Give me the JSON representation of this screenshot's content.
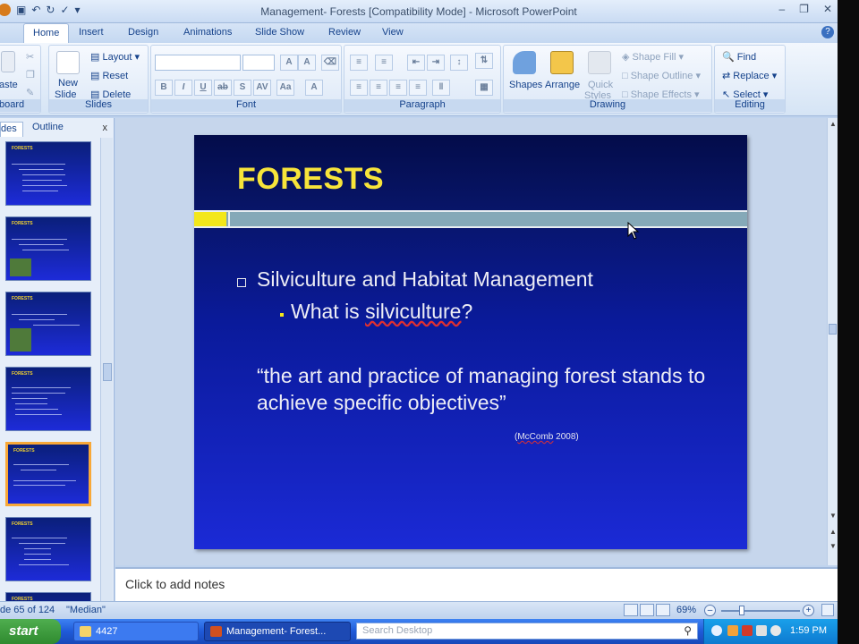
{
  "window": {
    "title": "Management- Forests [Compatibility Mode] - Microsoft PowerPoint"
  },
  "ribbon": {
    "tabs": [
      "Home",
      "Insert",
      "Design",
      "Animations",
      "Slide Show",
      "Review",
      "View"
    ],
    "clipboard": {
      "paste": "aste",
      "label": "board"
    },
    "slides": {
      "new_slide_line1": "New",
      "new_slide_line2": "Slide",
      "layout": "Layout",
      "reset": "Reset",
      "delete": "Delete",
      "label": "Slides"
    },
    "font": {
      "label": "Font"
    },
    "paragraph": {
      "label": "Paragraph"
    },
    "drawing": {
      "shapes": "Shapes",
      "arrange": "Arrange",
      "quick_styles_1": "Quick",
      "quick_styles_2": "Styles",
      "shape_fill": "Shape Fill",
      "shape_outline": "Shape Outline",
      "shape_effects": "Shape Effects",
      "label": "Drawing"
    },
    "editing": {
      "find": "Find",
      "replace": "Replace",
      "select": "Select",
      "label": "Editing"
    }
  },
  "left_pane": {
    "tab_slides": "des",
    "tab_outline": "Outline",
    "close": "x",
    "thumb_title": "FORESTS"
  },
  "slide": {
    "title": "FORESTS",
    "bullet1": "Silviculture and Habitat Management",
    "bullet2_prefix": "What is ",
    "bullet2_word": "silviculture",
    "bullet2_suffix": "?",
    "quote": "“the art and practice of managing forest stands to achieve specific objectives”",
    "citation_author": "McComb",
    "citation_year": " 2008)",
    "citation_open": "("
  },
  "notes": {
    "placeholder": "Click to add notes"
  },
  "statusbar": {
    "slide_count": "de 65 of 124",
    "theme": "\"Median\"",
    "zoom": "69%"
  },
  "taskbar": {
    "start": "start",
    "folder_btn": "4427",
    "ppt_btn": "Management- Forest...",
    "search_placeholder": "Search Desktop",
    "clock": "1:59 PM"
  },
  "colors": {
    "slide_title": "#f7e43a",
    "accent_band": "#85a9b8",
    "thumb_selected": "#f8a838"
  }
}
